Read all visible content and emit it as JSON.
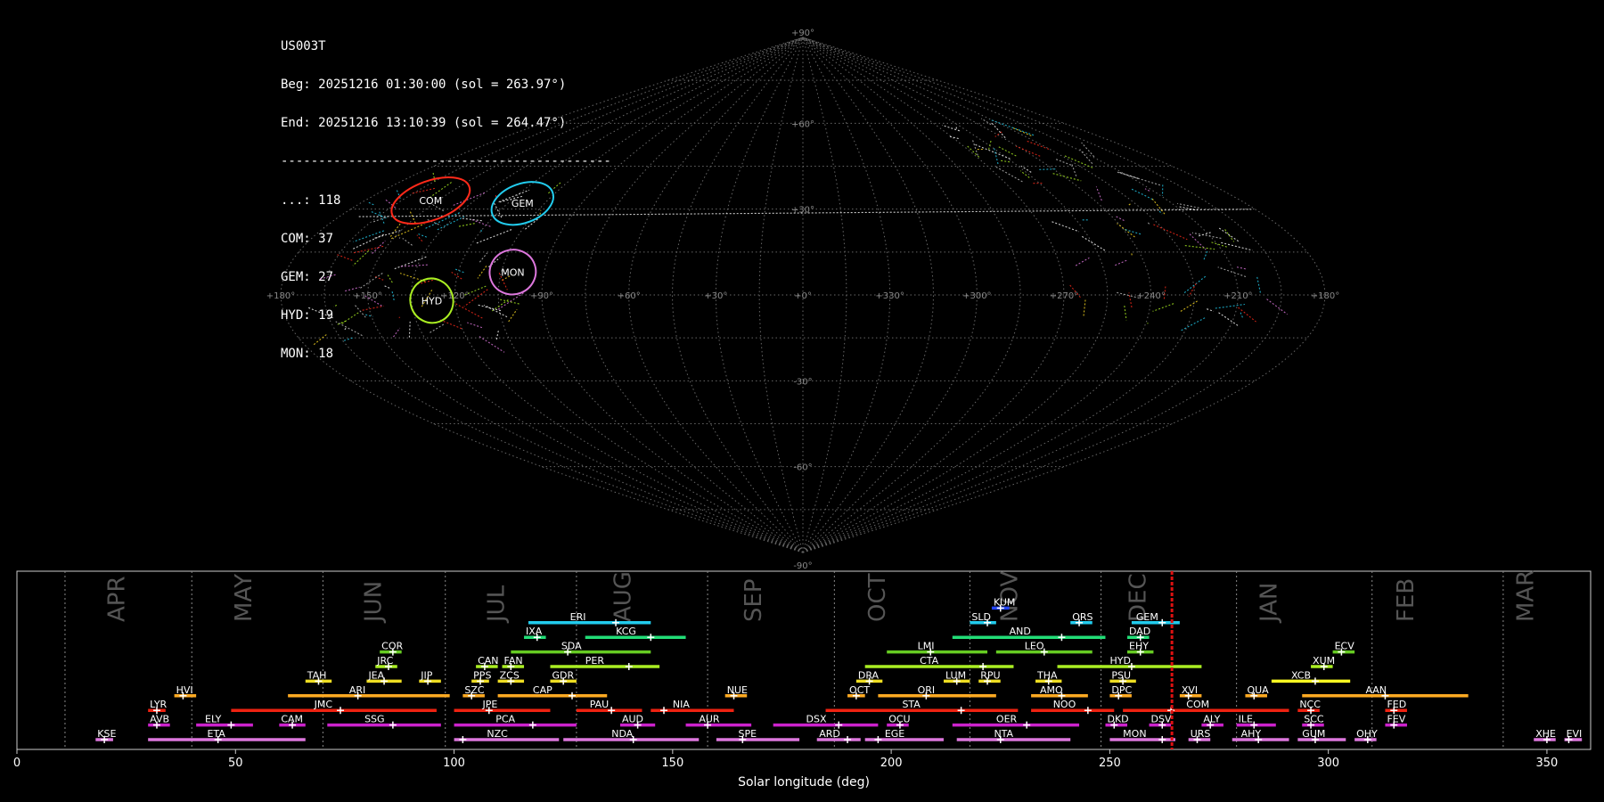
{
  "info": {
    "station": "US003T",
    "beg": "Beg: 20251216 01:30:00 (sol = 263.97°)",
    "end": "End: 20251216 13:10:39 (sol = 264.47°)",
    "separator": "--------------------------------------------",
    "counts": [
      {
        "text": "...: 118"
      },
      {
        "text": "COM: 37"
      },
      {
        "text": "GEM: 27"
      },
      {
        "text": "HYD: 19"
      },
      {
        "text": "MON: 18"
      }
    ]
  },
  "chart_data": [
    {
      "type": "scatter",
      "projection": "sinusoidal",
      "lon_labels": [
        "+180°",
        "+150°",
        "+120°",
        "+90°",
        "+60°",
        "+30°",
        "+0°",
        "+330°",
        "+300°",
        "+270°",
        "+240°",
        "+210°",
        "+180°"
      ],
      "lat_labels": [
        "+90°",
        "+60°",
        "+30°",
        "-30°",
        "-60°",
        "-90°"
      ],
      "lon_ticks": [
        180,
        150,
        120,
        90,
        60,
        30,
        0,
        330,
        300,
        270,
        240,
        210,
        180
      ],
      "lat_ticks": [
        90,
        60,
        30,
        -30,
        -60,
        -90
      ],
      "showers": [
        {
          "name": "COM",
          "lon": 153,
          "lat": 33,
          "color": "#ff2a1a"
        },
        {
          "name": "GEM",
          "lon": 114,
          "lat": 32,
          "color": "#22ccee"
        },
        {
          "name": "MON",
          "lon": 101,
          "lat": 8,
          "color": "#dd77dd"
        },
        {
          "name": "HYD",
          "lon": 128,
          "lat": -2,
          "color": "#aaee22"
        }
      ],
      "grid": true
    },
    {
      "type": "bar",
      "xlabel": "Solar longitude (deg)",
      "xlim": [
        0,
        360
      ],
      "xticks": [
        0,
        50,
        100,
        150,
        200,
        250,
        300,
        350
      ],
      "current_sol": 264.22,
      "months": [
        {
          "name": "APR",
          "sol": 24.6
        },
        {
          "name": "MAY",
          "sol": 53.6
        },
        {
          "name": "JUN",
          "sol": 83.3
        },
        {
          "name": "JUL",
          "sol": 111.4
        },
        {
          "name": "AUG",
          "sol": 140.4
        },
        {
          "name": "SEP",
          "sol": 170.2
        },
        {
          "name": "OCT",
          "sol": 198.6
        },
        {
          "name": "NOV",
          "sol": 228.8
        },
        {
          "name": "DEC",
          "sol": 258.2
        },
        {
          "name": "JAN",
          "sol": 288.1
        },
        {
          "name": "FEB",
          "sol": 319.4
        },
        {
          "name": "MAR",
          "sol": 346.9
        }
      ],
      "month_lines": [
        11.0,
        40.0,
        70.0,
        98.0,
        128.0,
        158.0,
        187.0,
        218.0,
        248.0,
        279.0,
        310.0,
        340.0
      ],
      "showers": [
        {
          "name": "KUM",
          "start": 223,
          "end": 227,
          "peak": 225,
          "row": 10,
          "color": "#2244ff"
        },
        {
          "name": "ERI",
          "start": 117,
          "end": 145,
          "peak": 137,
          "row": 9,
          "color": "#22ccee"
        },
        {
          "name": "SLD",
          "start": 218,
          "end": 224,
          "peak": 222,
          "row": 9,
          "color": "#22ccee"
        },
        {
          "name": "ORS",
          "start": 241,
          "end": 246,
          "peak": 243,
          "row": 9,
          "color": "#22ccee"
        },
        {
          "name": "GEM",
          "start": 255,
          "end": 266,
          "peak": 262,
          "row": 9,
          "color": "#22ccee"
        },
        {
          "name": "IXA",
          "start": 116,
          "end": 121,
          "peak": 119,
          "row": 8,
          "color": "#22dd77"
        },
        {
          "name": "KCG",
          "start": 130,
          "end": 153,
          "peak": 145,
          "row": 8,
          "color": "#22dd77"
        },
        {
          "name": "AND",
          "start": 214,
          "end": 249,
          "peak": 239,
          "row": 8,
          "color": "#22dd77"
        },
        {
          "name": "DAD",
          "start": 254,
          "end": 259,
          "peak": 257,
          "row": 8,
          "color": "#22dd77"
        },
        {
          "name": "COR",
          "start": 83,
          "end": 88,
          "peak": 86,
          "row": 7,
          "color": "#66cc22"
        },
        {
          "name": "SDA",
          "start": 113,
          "end": 145,
          "peak": 126,
          "row": 7,
          "color": "#66cc22"
        },
        {
          "name": "LMI",
          "start": 199,
          "end": 222,
          "peak": 209,
          "row": 7,
          "color": "#66cc22"
        },
        {
          "name": "LEO",
          "start": 224,
          "end": 246,
          "peak": 235,
          "row": 7,
          "color": "#66cc22"
        },
        {
          "name": "EHY",
          "start": 254,
          "end": 260,
          "peak": 257,
          "row": 7,
          "color": "#66cc22"
        },
        {
          "name": "ECV",
          "start": 301,
          "end": 306,
          "peak": 303,
          "row": 7,
          "color": "#66cc22"
        },
        {
          "name": "JRC",
          "start": 82,
          "end": 87,
          "peak": 85,
          "row": 6,
          "color": "#aaee22"
        },
        {
          "name": "CAN",
          "start": 105,
          "end": 110,
          "peak": 107,
          "row": 6,
          "color": "#aaee22"
        },
        {
          "name": "FAN",
          "start": 111,
          "end": 116,
          "peak": 113,
          "row": 6,
          "color": "#aaee22"
        },
        {
          "name": "PER",
          "start": 122,
          "end": 147,
          "peak": 140,
          "row": 6,
          "color": "#aaee22"
        },
        {
          "name": "CTA",
          "start": 194,
          "end": 228,
          "peak": 221,
          "row": 6,
          "color": "#aaee22"
        },
        {
          "name": "HYD",
          "start": 238,
          "end": 271,
          "peak": 255,
          "row": 6,
          "color": "#aaee22"
        },
        {
          "name": "XUM",
          "start": 296,
          "end": 301,
          "peak": 299,
          "row": 6,
          "color": "#aaee22"
        },
        {
          "name": "TAH",
          "start": 66,
          "end": 72,
          "peak": 69,
          "row": 5,
          "color": "#eedd22"
        },
        {
          "name": "JEA",
          "start": 80,
          "end": 88,
          "peak": 84,
          "row": 5,
          "color": "#eedd22"
        },
        {
          "name": "JIP",
          "start": 92,
          "end": 97,
          "peak": 94,
          "row": 5,
          "color": "#eedd22"
        },
        {
          "name": "PPS",
          "start": 104,
          "end": 108,
          "peak": 106,
          "row": 5,
          "color": "#eedd22"
        },
        {
          "name": "ZCS",
          "start": 110,
          "end": 116,
          "peak": 113,
          "row": 5,
          "color": "#eedd22"
        },
        {
          "name": "GDR",
          "start": 122,
          "end": 128,
          "peak": 125,
          "row": 5,
          "color": "#eedd22"
        },
        {
          "name": "DRA",
          "start": 192,
          "end": 198,
          "peak": 195,
          "row": 5,
          "color": "#eedd22"
        },
        {
          "name": "LUM",
          "start": 212,
          "end": 218,
          "peak": 215,
          "row": 5,
          "color": "#eedd22"
        },
        {
          "name": "RPU",
          "start": 220,
          "end": 225,
          "peak": 222,
          "row": 5,
          "color": "#eedd22"
        },
        {
          "name": "THA",
          "start": 233,
          "end": 239,
          "peak": 236,
          "row": 5,
          "color": "#eedd22"
        },
        {
          "name": "PSU",
          "start": 250,
          "end": 256,
          "peak": 253,
          "row": 5,
          "color": "#eedd22"
        },
        {
          "name": "XCB",
          "start": 287,
          "end": 305,
          "peak": 297,
          "row": 5,
          "color": "#ffff22"
        },
        {
          "name": "HVI",
          "start": 36,
          "end": 41,
          "peak": 38,
          "row": 4,
          "color": "#ffaa22"
        },
        {
          "name": "ARI",
          "start": 62,
          "end": 99,
          "peak": 78,
          "row": 4,
          "color": "#ffaa22"
        },
        {
          "name": "SZC",
          "start": 102,
          "end": 107,
          "peak": 104,
          "row": 4,
          "color": "#ffaa22"
        },
        {
          "name": "CAP",
          "start": 110,
          "end": 135,
          "peak": 127,
          "row": 4,
          "color": "#ffaa22"
        },
        {
          "name": "NUE",
          "start": 162,
          "end": 167,
          "peak": 164,
          "row": 4,
          "color": "#ffaa22"
        },
        {
          "name": "OCT",
          "start": 190,
          "end": 194,
          "peak": 192,
          "row": 4,
          "color": "#ffaa22"
        },
        {
          "name": "ORI",
          "start": 197,
          "end": 224,
          "peak": 208,
          "row": 4,
          "color": "#ffaa22"
        },
        {
          "name": "AMO",
          "start": 232,
          "end": 245,
          "peak": 239,
          "row": 4,
          "color": "#ffaa22"
        },
        {
          "name": "DPC",
          "start": 250,
          "end": 255,
          "peak": 252,
          "row": 4,
          "color": "#ffaa22"
        },
        {
          "name": "XVI",
          "start": 266,
          "end": 271,
          "peak": 268,
          "row": 4,
          "color": "#ffaa22"
        },
        {
          "name": "QUA",
          "start": 281,
          "end": 286,
          "peak": 283,
          "row": 4,
          "color": "#ffaa22"
        },
        {
          "name": "AAN",
          "start": 294,
          "end": 332,
          "peak": 313,
          "row": 4,
          "color": "#ffaa22"
        },
        {
          "name": "LYR",
          "start": 30,
          "end": 34,
          "peak": 32,
          "row": 3,
          "color": "#ee2211"
        },
        {
          "name": "JMC",
          "start": 49,
          "end": 96,
          "peak": 74,
          "row": 3,
          "color": "#ee2211"
        },
        {
          "name": "JPE",
          "start": 100,
          "end": 122,
          "peak": 108,
          "row": 3,
          "color": "#ee2211"
        },
        {
          "name": "PAU",
          "start": 128,
          "end": 143,
          "peak": 136,
          "row": 3,
          "color": "#ee2211"
        },
        {
          "name": "NIA",
          "start": 145,
          "end": 164,
          "peak": 148,
          "row": 3,
          "color": "#ee2211"
        },
        {
          "name": "STA",
          "start": 185,
          "end": 229,
          "peak": 216,
          "row": 3,
          "color": "#ee2211"
        },
        {
          "name": "NOO",
          "start": 232,
          "end": 251,
          "peak": 245,
          "row": 3,
          "color": "#ee2211"
        },
        {
          "name": "COM",
          "start": 253,
          "end": 291,
          "peak": 264,
          "row": 3,
          "color": "#ee2211"
        },
        {
          "name": "NCC",
          "start": 293,
          "end": 298,
          "peak": 296,
          "row": 3,
          "color": "#ee2211"
        },
        {
          "name": "FED",
          "start": 313,
          "end": 318,
          "peak": 315,
          "row": 3,
          "color": "#ee2211"
        },
        {
          "name": "AVB",
          "start": 30,
          "end": 35,
          "peak": 32,
          "row": 2,
          "color": "#cc22cc"
        },
        {
          "name": "ELY",
          "start": 41,
          "end": 54,
          "peak": 49,
          "row": 2,
          "color": "#cc22cc"
        },
        {
          "name": "CAM",
          "start": 60,
          "end": 66,
          "peak": 63,
          "row": 2,
          "color": "#cc22cc"
        },
        {
          "name": "SSG",
          "start": 71,
          "end": 97,
          "peak": 86,
          "row": 2,
          "color": "#cc22cc"
        },
        {
          "name": "PCA",
          "start": 100,
          "end": 128,
          "peak": 118,
          "row": 2,
          "color": "#cc22cc"
        },
        {
          "name": "AUD",
          "start": 138,
          "end": 146,
          "peak": 142,
          "row": 2,
          "color": "#cc22cc"
        },
        {
          "name": "AUR",
          "start": 153,
          "end": 168,
          "peak": 158,
          "row": 2,
          "color": "#cc22cc"
        },
        {
          "name": "DSX",
          "start": 173,
          "end": 197,
          "peak": 188,
          "row": 2,
          "color": "#cc22cc"
        },
        {
          "name": "OCU",
          "start": 199,
          "end": 204,
          "peak": 202,
          "row": 2,
          "color": "#cc22cc"
        },
        {
          "name": "OER",
          "start": 214,
          "end": 243,
          "peak": 231,
          "row": 2,
          "color": "#cc22cc"
        },
        {
          "name": "DKD",
          "start": 249,
          "end": 254,
          "peak": 251,
          "row": 2,
          "color": "#cc22cc"
        },
        {
          "name": "DSV",
          "start": 259,
          "end": 264,
          "peak": 262,
          "row": 2,
          "color": "#cc22cc"
        },
        {
          "name": "ALY",
          "start": 271,
          "end": 276,
          "peak": 273,
          "row": 2,
          "color": "#cc22cc"
        },
        {
          "name": "ILE",
          "start": 279,
          "end": 288,
          "peak": 283,
          "row": 2,
          "color": "#cc22cc"
        },
        {
          "name": "SCC",
          "start": 294,
          "end": 299,
          "peak": 296,
          "row": 2,
          "color": "#cc22cc"
        },
        {
          "name": "FEV",
          "start": 313,
          "end": 318,
          "peak": 315,
          "row": 2,
          "color": "#cc22cc"
        },
        {
          "name": "KSE",
          "start": 18,
          "end": 22,
          "peak": 20,
          "row": 1,
          "color": "#dd77dd"
        },
        {
          "name": "ETA",
          "start": 30,
          "end": 66,
          "peak": 46,
          "row": 1,
          "color": "#dd77dd"
        },
        {
          "name": "NZC",
          "start": 100,
          "end": 124,
          "peak": 102,
          "row": 1,
          "color": "#dd77dd"
        },
        {
          "name": "NDA",
          "start": 125,
          "end": 156,
          "peak": 141,
          "row": 1,
          "color": "#dd77dd"
        },
        {
          "name": "SPE",
          "start": 160,
          "end": 179,
          "peak": 166,
          "row": 1,
          "color": "#dd77dd"
        },
        {
          "name": "ARD",
          "start": 183,
          "end": 193,
          "peak": 190,
          "row": 1,
          "color": "#dd77dd"
        },
        {
          "name": "EGE",
          "start": 194,
          "end": 212,
          "peak": 197,
          "row": 1,
          "color": "#dd77dd"
        },
        {
          "name": "NTA",
          "start": 215,
          "end": 241,
          "peak": 225,
          "row": 1,
          "color": "#dd77dd"
        },
        {
          "name": "MON",
          "start": 250,
          "end": 265,
          "peak": 262,
          "row": 1,
          "color": "#dd77dd"
        },
        {
          "name": "URS",
          "start": 268,
          "end": 273,
          "peak": 270,
          "row": 1,
          "color": "#dd77dd"
        },
        {
          "name": "AHY",
          "start": 278,
          "end": 291,
          "peak": 284,
          "row": 1,
          "color": "#dd77dd"
        },
        {
          "name": "GUM",
          "start": 293,
          "end": 304,
          "peak": 297,
          "row": 1,
          "color": "#dd77dd"
        },
        {
          "name": "OHY",
          "start": 306,
          "end": 311,
          "peak": 309,
          "row": 1,
          "color": "#dd77dd"
        },
        {
          "name": "XHE",
          "start": 347,
          "end": 352,
          "peak": 350,
          "row": 1,
          "color": "#dd77dd"
        },
        {
          "name": "EVI",
          "start": 354,
          "end": 358,
          "peak": 355,
          "row": 1,
          "color": "#dd77dd"
        }
      ]
    }
  ]
}
